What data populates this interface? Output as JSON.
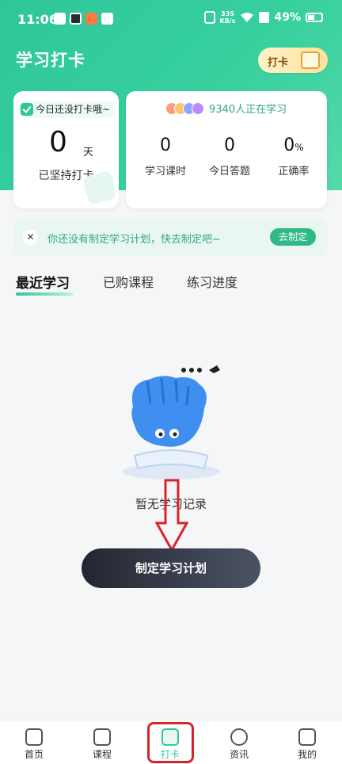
{
  "status_bar": {
    "time": "11:06",
    "net_speed_value": "335",
    "net_speed_unit": "KB/s",
    "battery": "49%"
  },
  "header": {
    "title": "学习打卡",
    "checkin_badge": "打卡"
  },
  "streak_card": {
    "today_tag": "今日还没打卡哦~",
    "days": "0",
    "unit": "天",
    "label": "已坚持打卡"
  },
  "stats_card": {
    "learners": "9340人正在学习",
    "stats": [
      {
        "value": "0",
        "unit": "",
        "label": "学习课时"
      },
      {
        "value": "0",
        "unit": "",
        "label": "今日答题"
      },
      {
        "value": "0",
        "unit": "%",
        "label": "正确率"
      }
    ]
  },
  "plan_banner": {
    "close_glyph": "✕",
    "text": "你还没有制定学习计划，快去制定吧~",
    "button": "去制定"
  },
  "tabs": [
    {
      "label": "最近学习",
      "active": true
    },
    {
      "label": "已购课程",
      "active": false
    },
    {
      "label": "练习进度",
      "active": false
    }
  ],
  "empty_state": {
    "text": "暂无学习记录"
  },
  "primary_button": "制定学习计划",
  "bottom_nav": [
    {
      "label": "首页",
      "icon": "home-icon"
    },
    {
      "label": "课程",
      "icon": "course-play-icon"
    },
    {
      "label": "打卡",
      "icon": "calendar-check-icon",
      "active": true
    },
    {
      "label": "资讯",
      "icon": "compass-icon"
    },
    {
      "label": "我的",
      "icon": "profile-icon"
    }
  ],
  "colors": {
    "brand": "#2fc79a",
    "annotation": "#d9242a"
  }
}
